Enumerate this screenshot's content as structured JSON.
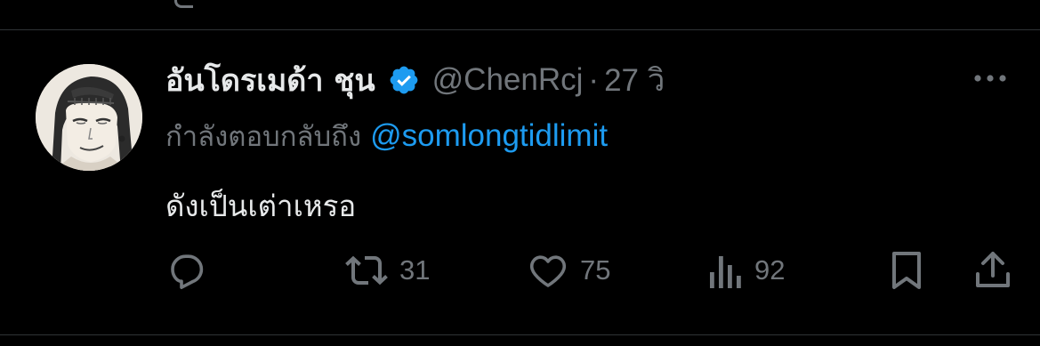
{
  "tweet": {
    "display_name": "อันโดรเมด้า ชุน",
    "verified_icon": "verified-badge-icon",
    "handle": "@ChenRcj",
    "separator": "·",
    "time": "27 วิ",
    "reply_prefix": "กำลังตอบกลับถึง",
    "reply_target": "@somlongtidlimit",
    "text": "ดังเป็นเต่าเหรอ"
  },
  "actions": {
    "reply": {
      "icon": "reply-icon",
      "count": ""
    },
    "retweet": {
      "icon": "retweet-icon",
      "count": "31"
    },
    "like": {
      "icon": "heart-icon",
      "count": "75"
    },
    "views": {
      "icon": "views-icon",
      "count": "92"
    },
    "bookmark": {
      "icon": "bookmark-icon",
      "count": ""
    },
    "share": {
      "icon": "share-icon",
      "count": ""
    }
  },
  "colors": {
    "background": "#000000",
    "primary_text": "#e7e9ea",
    "secondary_text": "#71767b",
    "link": "#1d9bf0",
    "verified": "#1d9bf0",
    "divider": "#2f3336"
  }
}
